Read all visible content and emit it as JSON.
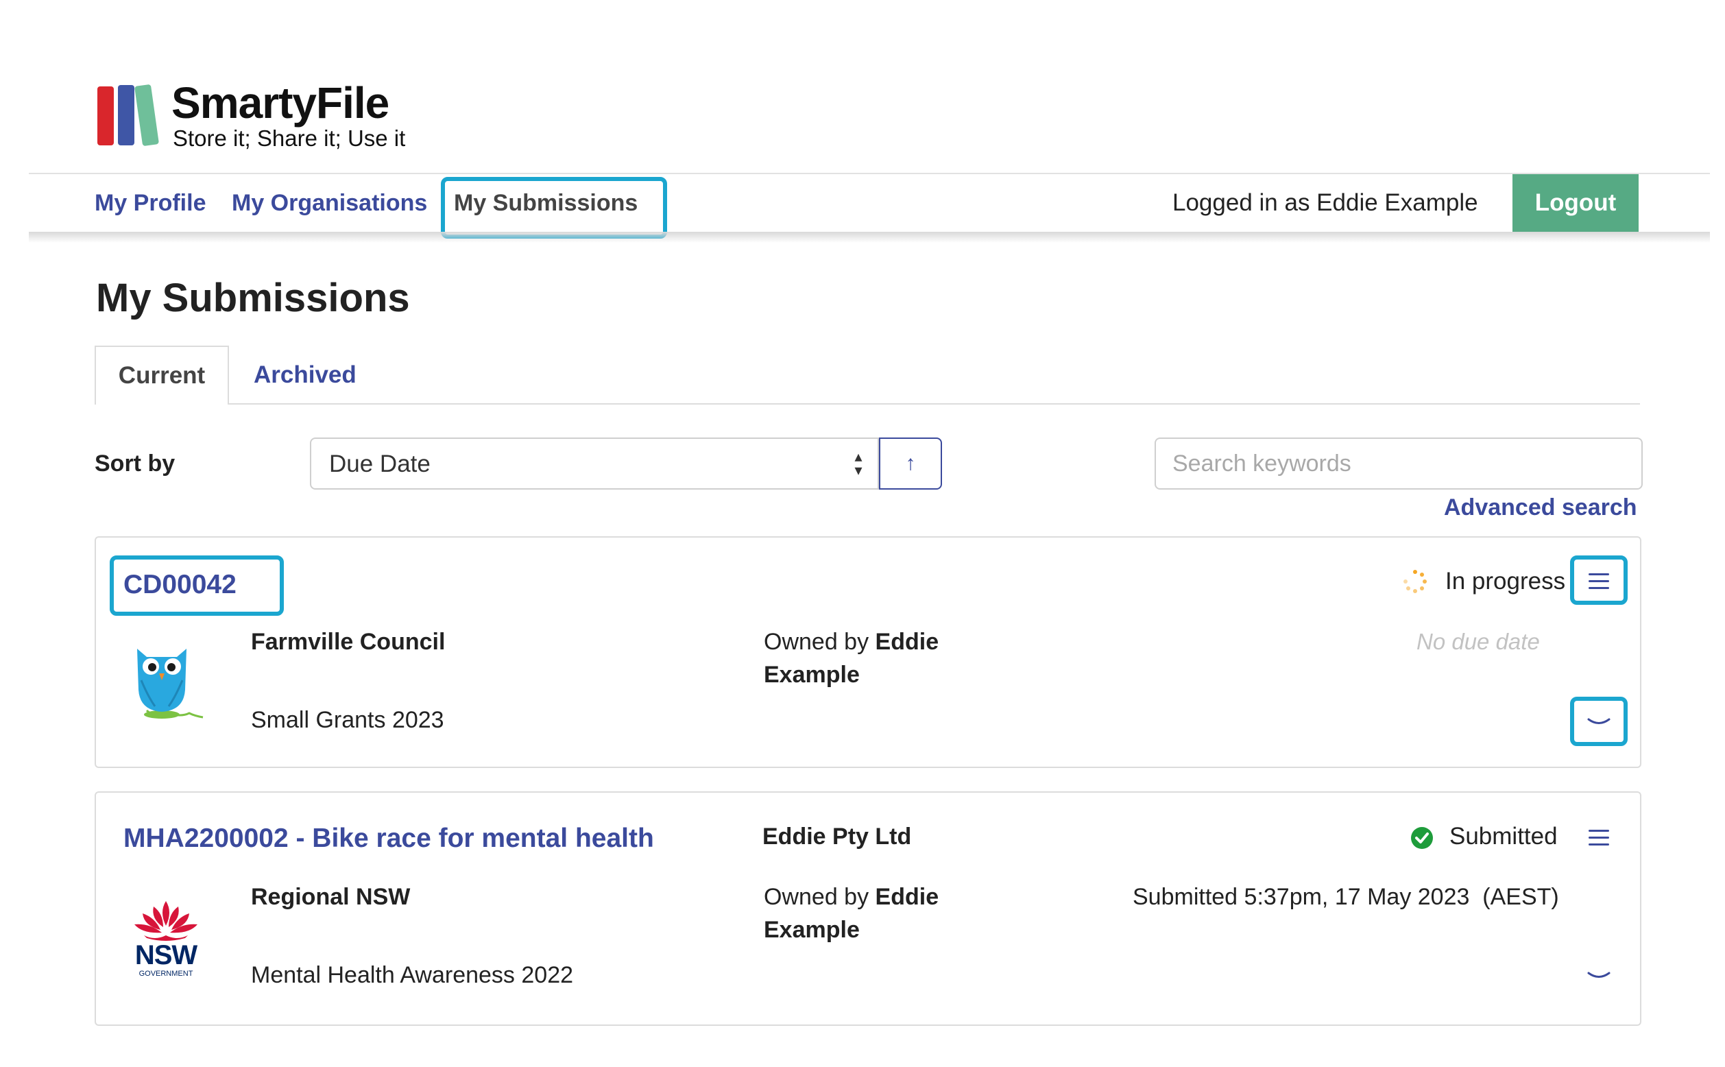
{
  "brand": {
    "name": "SmartyFile",
    "tagline": "Store it; Share it; Use it",
    "colors": {
      "bar_red": "#d9262c",
      "bar_blue": "#3f56a6",
      "bar_green": "#6fbf9a"
    }
  },
  "nav": {
    "links": [
      "My Profile",
      "My Organisations",
      "My Submissions"
    ],
    "active": "My Submissions",
    "logged_in_text": "Logged in as Eddie Example",
    "logout_label": "Logout"
  },
  "page": {
    "title": "My Submissions",
    "tabs": [
      "Current",
      "Archived"
    ],
    "active_tab": "Current"
  },
  "controls": {
    "sort_label": "Sort by",
    "sort_value": "Due Date",
    "sort_direction_icon": "arrow-up-icon",
    "search_placeholder": "Search keywords",
    "advanced_search": "Advanced search"
  },
  "submissions": [
    {
      "id_title": "CD00042",
      "organisation": "Farmville Council",
      "program": "Small Grants 2023",
      "owned_prefix": "Owned by",
      "owner": "Eddie Example",
      "owner_first": "Eddie",
      "owner_last": "Example",
      "status": "In progress",
      "status_icon": "spinner-icon",
      "due": "No due date",
      "logo": "owl-logo"
    },
    {
      "id_title": "MHA2200002 - Bike race for mental health",
      "applicant": "Eddie Pty Ltd",
      "organisation": "Regional NSW",
      "program": "Mental Health Awareness 2022",
      "owned_prefix": "Owned by",
      "owner": "Eddie Example",
      "owner_first": "Eddie",
      "owner_last": "Example",
      "status": "Submitted",
      "status_icon": "check-circle-icon",
      "submitted_text": "Submitted 5:37pm, 17 May 2023  (AEST)",
      "logo": "nsw-government-logo",
      "logo_text": "NSW",
      "logo_subtext": "GOVERNMENT"
    }
  ],
  "colors": {
    "link": "#3b4a9c",
    "highlight": "#1ba6cf",
    "logout_bg": "#56aa84",
    "submitted_green": "#1e9c3b",
    "progress_orange": "#f5a623"
  }
}
